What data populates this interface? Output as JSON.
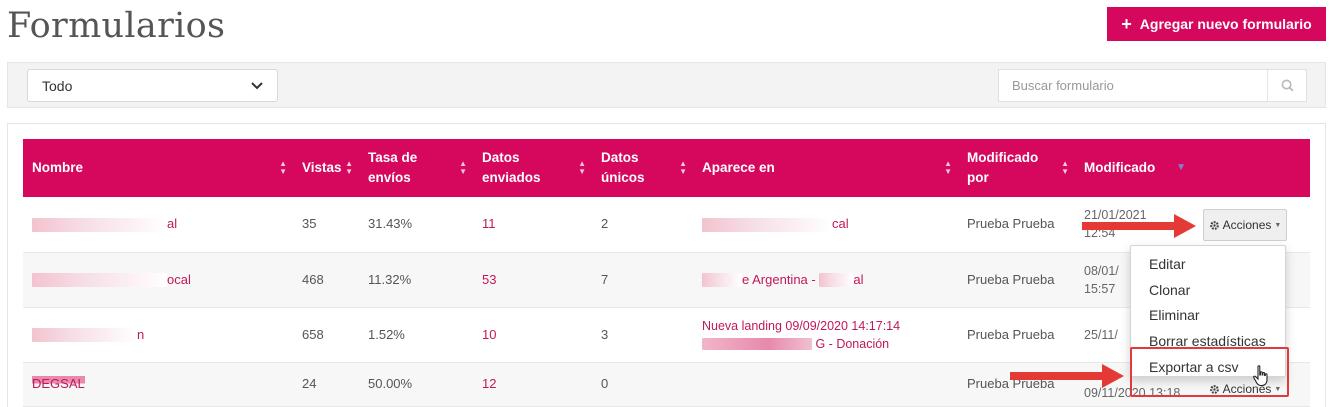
{
  "header": {
    "title": "Formularios",
    "add_button": "Agregar nuevo formulario"
  },
  "filters": {
    "select_value": "Todo",
    "search_placeholder": "Buscar formulario"
  },
  "table": {
    "columns": [
      "Nombre",
      "Vistas",
      "Tasa de envíos",
      "Datos enviados",
      "Datos únicos",
      "Aparece en",
      "Modificado por",
      "Modificado"
    ],
    "rows": [
      {
        "name": "al",
        "views": "35",
        "rate": "31.43%",
        "sent": "11",
        "unique": "2",
        "appears": "cal",
        "modified_by": "Prueba Prueba",
        "modified": "21/01/2021 12:54"
      },
      {
        "name": "ocal",
        "views": "468",
        "rate": "11.32%",
        "sent": "53",
        "unique": "7",
        "appears": "e Argentina -",
        "appears_tail": "al",
        "modified_by": "Prueba Prueba",
        "modified": "08/01/ 15:57"
      },
      {
        "name": "n",
        "views": "658",
        "rate": "1.52%",
        "sent": "10",
        "unique": "3",
        "appears": "Nueva landing 09/09/2020 14:17:14",
        "appears_line2": "G - Donación",
        "modified_by": "Prueba Prueba",
        "modified": "25/11/"
      },
      {
        "name": "DEGSAL",
        "views": "24",
        "rate": "50.00%",
        "sent": "12",
        "unique": "0",
        "appears": "",
        "modified_by": "Prueba Prueba",
        "modified": "09/11/2020 13:18"
      }
    ]
  },
  "actions": {
    "label": "Acciones",
    "menu": [
      "Editar",
      "Clonar",
      "Eliminar",
      "Borrar estadísticas",
      "Exportar a csv"
    ]
  },
  "colors": {
    "brand": "#d6085e",
    "link": "#c2185b",
    "annotation": "#e53935"
  },
  "icons": [
    "plus-icon",
    "chevron-down-icon",
    "search-icon",
    "sort-icon",
    "gear-icon",
    "caret-down-icon",
    "hand-cursor-icon",
    "arrow-annotation"
  ]
}
